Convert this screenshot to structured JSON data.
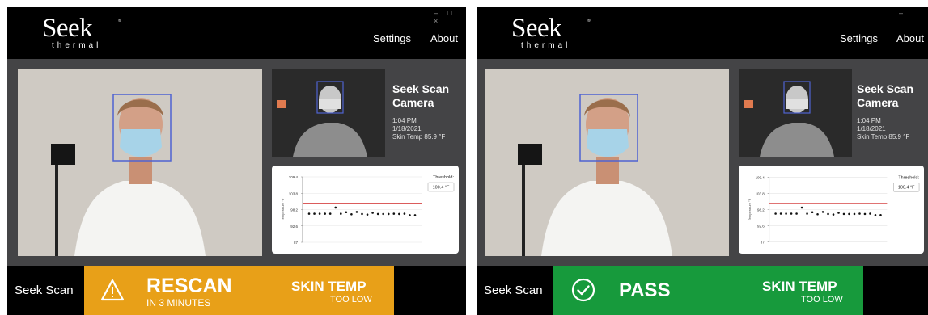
{
  "panels": [
    {
      "brand": {
        "word": "Seek",
        "sub": "thermal",
        "reg": "®"
      },
      "window_controls": "– □ ×",
      "nav": [
        "Settings",
        "About"
      ],
      "camera": {
        "title_line1": "Seek Scan",
        "title_line2": "Camera",
        "time": "1:04 PM",
        "date": "1/18/2021",
        "skin_temp": "Skin Temp 85.9 °F"
      },
      "graph": {
        "threshold_label": "Threshold:",
        "threshold_value": "100.4 °F",
        "y_ticks": [
          "109.4",
          "103.8",
          "98.2",
          "92.6",
          "87"
        ],
        "y_label": "Temperature °F"
      },
      "footer_brand": "Seek Scan",
      "banner": {
        "status": "RESCAN",
        "detail": "IN 3 MINUTES",
        "reason_line1": "SKIN TEMP",
        "reason_line2": "TOO LOW",
        "color": "#e8a018",
        "icon": "warning-icon"
      }
    },
    {
      "brand": {
        "word": "Seek",
        "sub": "thermal",
        "reg": "®"
      },
      "window_controls": "– □",
      "nav": [
        "Settings",
        "About"
      ],
      "camera": {
        "title_line1": "Seek Scan",
        "title_line2": "Camera",
        "time": "1:04 PM",
        "date": "1/18/2021",
        "skin_temp": "Skin Temp 85.9 °F"
      },
      "graph": {
        "threshold_label": "Threshold:",
        "threshold_value": "100.4 °F",
        "y_ticks": [
          "109.4",
          "103.8",
          "98.2",
          "92.6",
          "87"
        ],
        "y_label": "Temperature °F"
      },
      "footer_brand": "Seek Scan",
      "banner": {
        "status": "PASS",
        "reason_line1": "SKIN TEMP",
        "reason_line2": "TOO LOW",
        "color": "#179a3c",
        "icon": "check-circle-icon"
      }
    }
  ],
  "chart_data": {
    "type": "scatter",
    "ylabel": "Temperature °F",
    "ylim": [
      87,
      109.4
    ],
    "threshold": 100.4,
    "y": [
      96.8,
      96.8,
      96.8,
      96.8,
      96.8,
      98.9,
      96.8,
      97.3,
      96.6,
      97.4,
      96.7,
      96.5,
      97.1,
      96.7,
      96.7,
      96.7,
      96.8,
      96.7,
      96.8,
      96.3,
      96.3
    ]
  }
}
